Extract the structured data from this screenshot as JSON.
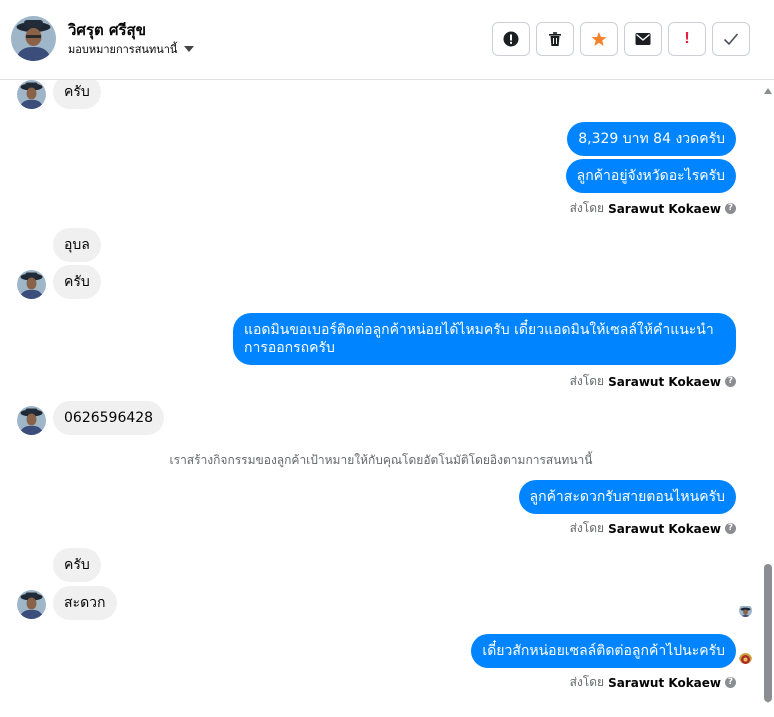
{
  "header": {
    "contact_name": "วิศรุต ศรีสุข",
    "assign_label": "มอบหมายการสนทนานี้"
  },
  "actions": [
    {
      "name": "alert-icon"
    },
    {
      "name": "trash-icon"
    },
    {
      "name": "star-icon",
      "color": "#f5822a"
    },
    {
      "name": "envelope-icon"
    },
    {
      "name": "spam-icon",
      "label": "!"
    },
    {
      "name": "check-icon"
    }
  ],
  "messages": {
    "m1": "ครับ",
    "m2": "8,329 บาท 84 งวดครับ",
    "m3": "ลูกค้าอยู่จังหวัดอะไรครับ",
    "m4": "อุบล",
    "m5": "ครับ",
    "m6": "แอดมินขอเบอร์ติดต่อลูกค้าหน่อยได้ไหมครับ เดี๋ยวแอดมินให้เซลล์ให้คำแนะนำการออกรถครับ",
    "m7": "0626596428",
    "m8": "ลูกค้าสะดวกรับสายตอนไหนครับ",
    "m9": "ครับ",
    "m10": "สะดวก",
    "m11": "เดี๋ยวสักหน่อยเซลล์ติดต่อลูกค้าไปนะครับ"
  },
  "system_note": "เราสร้างกิจกรรมของลูกค้าเป้าหมายให้กับคุณโดยอัตโนมัติโดยอิงตามการสนทนานี้",
  "sent_by": {
    "prefix": "ส่งโดย",
    "name": "Sarawut Kokaew",
    "help_icon": "?"
  },
  "colors": {
    "outgoing_bubble": "#0084ff",
    "incoming_bubble": "#f0f0f0",
    "muted_text": "#65676b"
  }
}
